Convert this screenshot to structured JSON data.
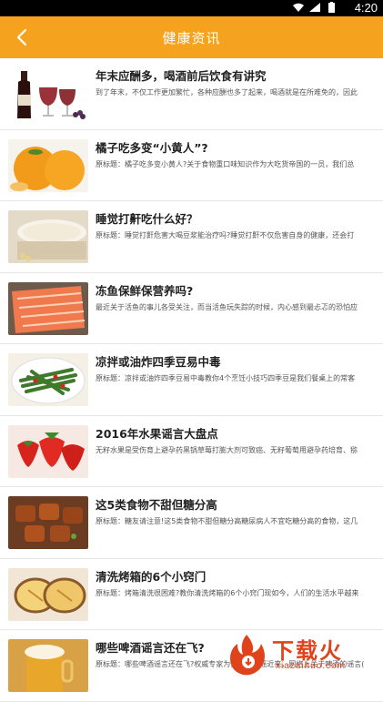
{
  "status_bar": {
    "time": "4:20"
  },
  "header": {
    "title": "健康资讯"
  },
  "articles": [
    {
      "title": "年末应酬多，喝酒前后饮食有讲究",
      "summary": "到了年末，不仅工作更加繁忙，各种应酬也多了起来，喝酒就是在所难免的，因此"
    },
    {
      "title": "橘子吃多变“小黄人”?",
      "summary": "原标题：橘子吃多变小黄人?关于食物重口味知识作为大吃货帝国的一员，我们总"
    },
    {
      "title": "睡觉打鼾吃什么好？",
      "summary": "原标题：睡觉打鼾危害大喝豆浆能治疗吗?睡觉打鼾不仅危害自身的健康，还会打"
    },
    {
      "title": "冻鱼保鲜保营养吗?",
      "summary": "最近关于活鱼的事儿各受关注，而当活鱼玩失踪的时候，内心感到最忐忑的恐怕应"
    },
    {
      "title": "凉拌或油炸四季豆易中毒",
      "summary": "原标题：凉拌或油炸四季豆易中毒教你4个烹饪小技巧四季豆是我们餐桌上的常客"
    },
    {
      "title": "2016年水果谣言大盘点",
      "summary": "无籽水果是受伤育上避孕药黑锅草莓打膨大剂可致癌、无籽葡萄用避孕药培育、猕"
    },
    {
      "title": "这5类食物不甜但糖分高",
      "summary": "原标题：糖友请注意!这5类食物不甜但糖分高糖尿病人不宜吃糖分高的食物，这几"
    },
    {
      "title": "清洗烤箱的6个小窍门",
      "summary": "原标题：烤箱清洗很困难?教你清洗烤箱的6个小窍门现如今，人们的生活水平越来"
    },
    {
      "title": "哪些啤酒谣言还在飞?",
      "summary": "原标题：哪些啤酒谣言还在飞?权威专家为你一一辟谣近来，网络上关于啤酒的谣言("
    }
  ],
  "watermark": {
    "text": "下载火",
    "url": "xiazaihuo.com"
  },
  "colors": {
    "header_bg": "#f5a31e",
    "divider": "#e6e6e6",
    "watermark": "#e0431c"
  }
}
